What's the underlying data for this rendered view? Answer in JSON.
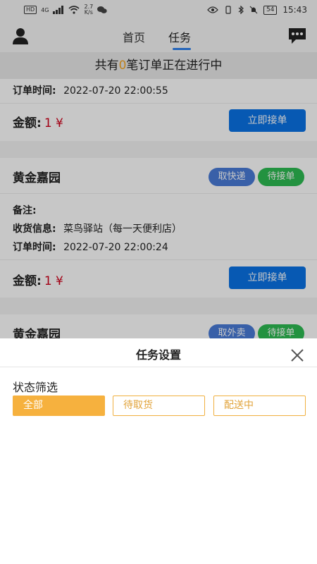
{
  "status_bar": {
    "net_tag": "HD",
    "signal": "4G",
    "speed_top": "2.7",
    "speed_bottom": "K/s",
    "battery": "54",
    "time": "15:43"
  },
  "nav": {
    "tab_home": "首页",
    "tab_tasks": "任务"
  },
  "banner": {
    "prefix": "共有",
    "count": "0",
    "suffix": "笔订单正在进行中"
  },
  "orders": [
    {
      "order_time_label": "订单时间:",
      "order_time": "2022-07-20 22:00:55",
      "amount_label": "金额:",
      "amount": "1 ¥",
      "accept_label": "立即接单"
    },
    {
      "shop": "黄金嘉园",
      "tag_type": "取快递",
      "tag_status": "待接单",
      "note_label": "备注:",
      "receive_label": "收货信息:",
      "receive_value": "菜鸟驿站（每一天便利店）",
      "order_time_label": "订单时间:",
      "order_time": "2022-07-20 22:00:24",
      "amount_label": "金额:",
      "amount": "1 ¥",
      "accept_label": "立即接单"
    },
    {
      "shop": "黄金嘉园",
      "tag_type": "取外卖",
      "tag_status": "待接单"
    }
  ],
  "sheet": {
    "title": "任务设置",
    "filter_label": "状态筛选",
    "options": [
      "全部",
      "待取货",
      "配送中"
    ],
    "selected": "全部"
  },
  "colors": {
    "accent_blue": "#0a73e6",
    "amount_red": "#d0021b",
    "filter_orange": "#f6b13e",
    "tag_blue": "#4a7bd8",
    "tag_green": "#2dbb52"
  }
}
